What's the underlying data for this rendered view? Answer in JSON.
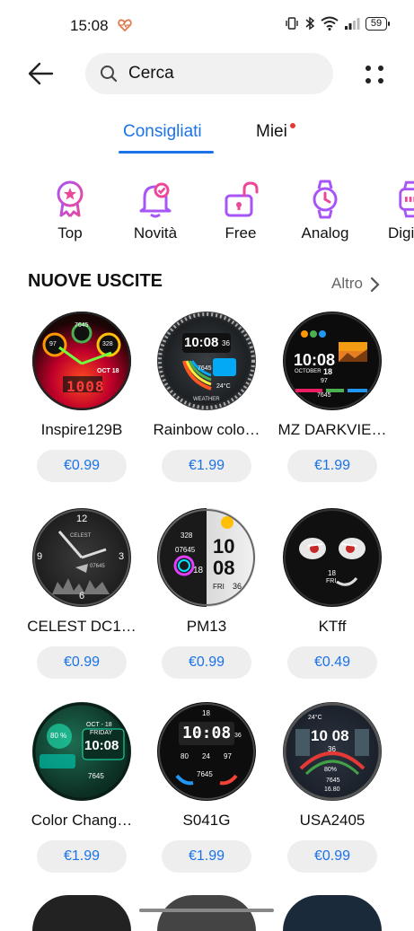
{
  "status": {
    "time": "15:08",
    "battery": "59"
  },
  "search": {
    "placeholder": "Cerca"
  },
  "tabs": [
    {
      "label": "Consigliati"
    },
    {
      "label": "Miei"
    }
  ],
  "categories": [
    {
      "label": "Top",
      "icon": "ribbon-star-icon"
    },
    {
      "label": "Novità",
      "icon": "bell-check-icon"
    },
    {
      "label": "Free",
      "icon": "unlock-icon"
    },
    {
      "label": "Analog",
      "icon": "watch-icon"
    },
    {
      "label": "Digi",
      "icon": "digital-watch-icon"
    }
  ],
  "section": {
    "title": "NUOVE USCITE",
    "more": "Altro"
  },
  "items": [
    {
      "name": "Inspire129B",
      "price": "€0.99"
    },
    {
      "name": "Rainbow colo…",
      "price": "€1.99"
    },
    {
      "name": "MZ DARKVIE…",
      "price": "€1.99"
    },
    {
      "name": "CELEST DC1…",
      "price": "€0.99"
    },
    {
      "name": "PM13",
      "price": "€0.99"
    },
    {
      "name": "KTff",
      "price": "€0.49"
    },
    {
      "name": "Color Chang…",
      "price": "€1.99"
    },
    {
      "name": "S041G",
      "price": "€1.99"
    },
    {
      "name": "USA2405",
      "price": "€0.99"
    }
  ],
  "faces": {
    "inspire": {
      "top": "7645",
      "left": "97",
      "right": "328",
      "time": "1008",
      "date": "OCT 18"
    },
    "rainbow": {
      "time": "10:08",
      "day": "36",
      "steps": "7645",
      "temp": "24°C",
      "brand": "WEATHER"
    },
    "mz": {
      "time": "10:08",
      "month": "OCTOBER",
      "date": "18",
      "n1": "97",
      "n2": "7645"
    },
    "celest": {
      "brand": "CELEST",
      "n12": "12",
      "n3": "3",
      "n6": "6",
      "n9": "9",
      "sec": "07645"
    },
    "pm13": {
      "h": "10",
      "m": "08",
      "s": "36",
      "steps": "07645",
      "top": "328",
      "date": "18",
      "dow": "FRI"
    },
    "ktff": {
      "date": "18",
      "dow": "FRI"
    },
    "colorch": {
      "date": "OCT - 18",
      "dow": "FRIDAY",
      "time": "10:08",
      "pct": "80 %",
      "steps": "7645"
    },
    "s041g": {
      "time": "10:08",
      "day": "18",
      "s": "36",
      "a": "80",
      "b": "24",
      "c": "97",
      "steps": "7645"
    },
    "usa": {
      "time": "10 08",
      "s": "36",
      "temp": "24°C",
      "pct": "80%",
      "steps": "7645",
      "km": "16.80"
    }
  }
}
